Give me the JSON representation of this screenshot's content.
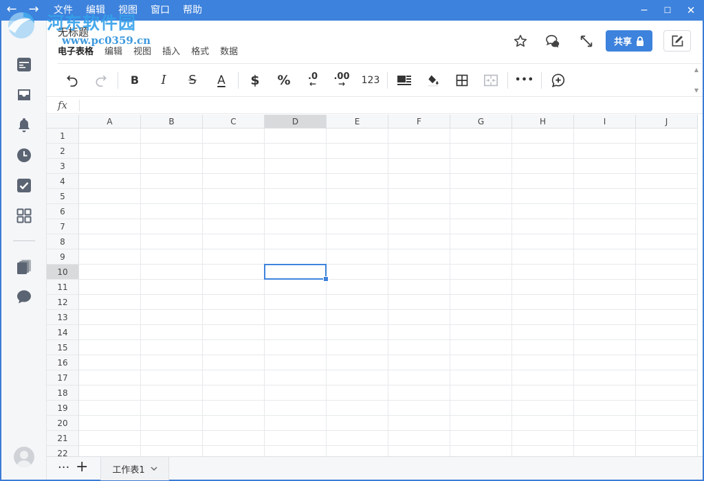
{
  "titlebar": {
    "back_glyph": "←",
    "forward_glyph": "→",
    "menu": [
      "文件",
      "编辑",
      "视图",
      "窗口",
      "帮助"
    ],
    "minimize_glyph": "−",
    "maximize_glyph": "☐",
    "close_glyph": "✕"
  },
  "watermark": {
    "line1": "河东软件园",
    "line2": "www.pc0359.cn"
  },
  "document": {
    "title": "无标题",
    "menu": [
      "电子表格",
      "编辑",
      "视图",
      "插入",
      "格式",
      "数据"
    ]
  },
  "header": {
    "share_label": "共享"
  },
  "toolbar": {
    "bold": "B",
    "italic": "I",
    "strike": "S",
    "font_color": "A",
    "currency": "$",
    "percent": "%",
    "dec_decrease": ".0",
    "dec_increase": ".00",
    "number_format": "123",
    "more": "•••",
    "scroll_up": "▲",
    "scroll_down": "▼"
  },
  "formula_bar": {
    "fx_label": "fx",
    "value": ""
  },
  "grid": {
    "columns": [
      "A",
      "B",
      "C",
      "D",
      "E",
      "F",
      "G",
      "H",
      "I",
      "J"
    ],
    "rows": [
      "1",
      "2",
      "3",
      "4",
      "5",
      "6",
      "7",
      "8",
      "9",
      "10",
      "11",
      "12",
      "13",
      "14",
      "15",
      "16",
      "17",
      "18",
      "19",
      "20",
      "21",
      "22"
    ],
    "selected_column": "D",
    "selected_row": "10"
  },
  "sheets": {
    "more_glyph": "···",
    "add_glyph": "+",
    "tabs": [
      {
        "label": "工作表1"
      }
    ]
  },
  "colors": {
    "accent": "#3d82dc",
    "selected_header": "#d9dadc"
  }
}
